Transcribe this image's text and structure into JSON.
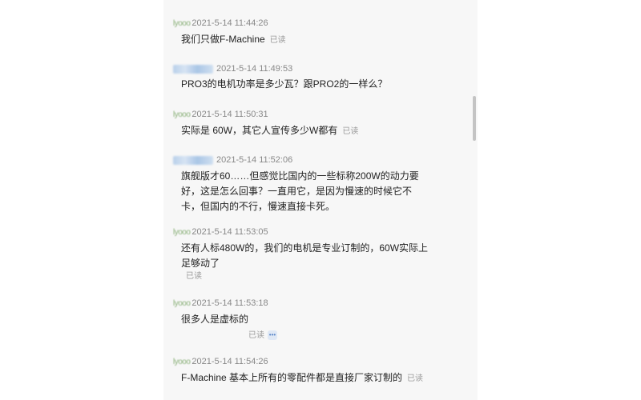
{
  "messages": [
    {
      "name": "lyooo",
      "time": "2021-5-14 11:44:26",
      "text": "我们只做F-Machine",
      "read": "已读"
    },
    {
      "name": "",
      "time": "2021-5-14 11:49:53",
      "text": "PRO3的电机功率是多少瓦？跟PRO2的一样么？"
    },
    {
      "name": "lyooo",
      "time": "2021-5-14 11:50:31",
      "text": "实际是 60W，其它人宣传多少W都有",
      "read": "已读"
    },
    {
      "name": "",
      "time": "2021-5-14 11:52:06",
      "text": "旗舰版才60……但感觉比国内的一些标称200W的动力要好，这是怎么回事？一直用它，是因为慢速的时候它不卡，但国内的不行，慢速直接卡死。"
    },
    {
      "name": "lyooo",
      "time": "2021-5-14 11:53:05",
      "text": "还有人标480W的，我们的电机是专业订制的，60W实际上足够动了",
      "read": "已读"
    },
    {
      "name": "lyooo",
      "time": "2021-5-14 11:53:18",
      "text": "很多人是虚标的",
      "read": "已读",
      "more_icon": "more-options-icon"
    },
    {
      "name": "lyooo",
      "time": "2021-5-14 11:54:26",
      "text": "F-Machine 基本上所有的零配件都是直接厂家订制的",
      "read": "已读"
    }
  ]
}
